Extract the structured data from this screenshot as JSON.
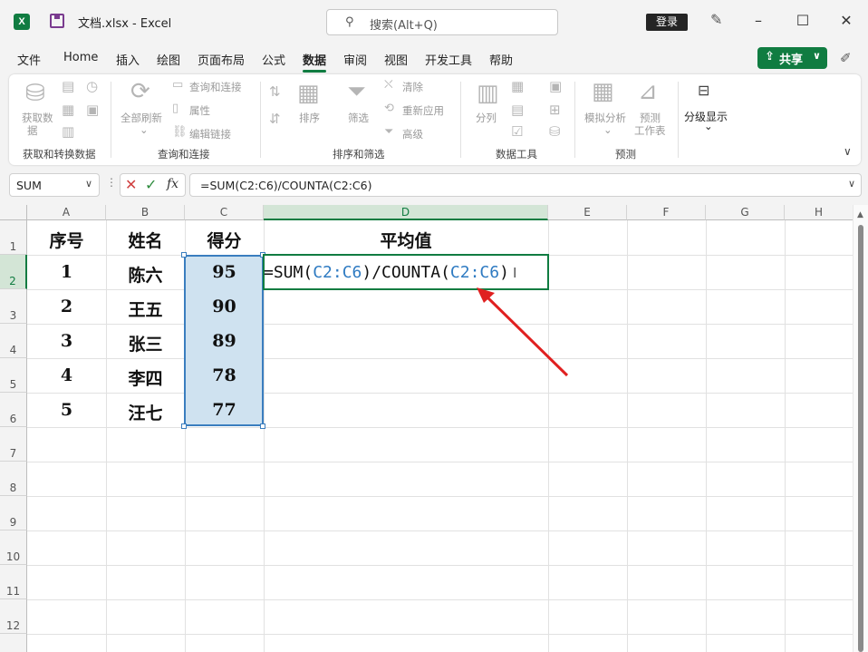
{
  "titlebar": {
    "logo": "X",
    "title": "文档.xlsx  -  Excel",
    "search_placeholder": "搜索(Alt+Q)",
    "login": "登录",
    "icons": [
      "excel-logo-icon",
      "save-icon",
      "search-icon",
      "pen-icon",
      "minimize-icon",
      "maximize-icon",
      "close-icon"
    ]
  },
  "menu": {
    "items": [
      "文件",
      "Home",
      "插入",
      "绘图",
      "页面布局",
      "公式",
      "数据",
      "审阅",
      "视图",
      "开发工具",
      "帮助"
    ],
    "active": "数据",
    "share": "共享"
  },
  "ribbon": {
    "groups": [
      {
        "label": "获取和转换数据",
        "buttons": [
          "获取数",
          "据"
        ]
      },
      {
        "label": "查询和连接",
        "buttons": [
          "全部刷新",
          "查询和连接",
          "属性",
          "编辑链接"
        ]
      },
      {
        "label": "排序和筛选",
        "buttons": [
          "排序",
          "筛选",
          "清除",
          "重新应用",
          "高级"
        ]
      },
      {
        "label": "数据工具",
        "buttons": [
          "分列"
        ]
      },
      {
        "label": "预测",
        "buttons": [
          "模拟分析",
          "预测",
          "工作表"
        ]
      },
      {
        "label": "",
        "buttons": [
          "分级显示"
        ]
      }
    ]
  },
  "formula_bar": {
    "name_box": "SUM",
    "formula": "=SUM(C2:C6)/COUNTA(C2:C6)",
    "fx": "fx"
  },
  "sheet": {
    "columns": [
      "A",
      "B",
      "C",
      "D",
      "E",
      "F",
      "G",
      "H"
    ],
    "rows": [
      "1",
      "2",
      "3",
      "4",
      "5",
      "6",
      "7",
      "8",
      "9",
      "10",
      "11",
      "12"
    ],
    "headers": [
      "序号",
      "姓名",
      "得分",
      "平均值"
    ],
    "data": [
      [
        "1",
        "陈六",
        "95"
      ],
      [
        "2",
        "王五",
        "90"
      ],
      [
        "3",
        "张三",
        "89"
      ],
      [
        "4",
        "李四",
        "78"
      ],
      [
        "5",
        "汪七",
        "77"
      ]
    ],
    "edit": {
      "p1": "=SUM(",
      "r1": "C2:C6",
      "p2": ")/COUNTA(",
      "r2": "C2:C6",
      "p3": ")"
    }
  },
  "colors": {
    "accent": "#107c41",
    "range_fill": "#cfe2f0",
    "range_border": "#3a7ebf",
    "ref_text": "#2f7bc2",
    "annotation_arrow": "#e02020"
  }
}
